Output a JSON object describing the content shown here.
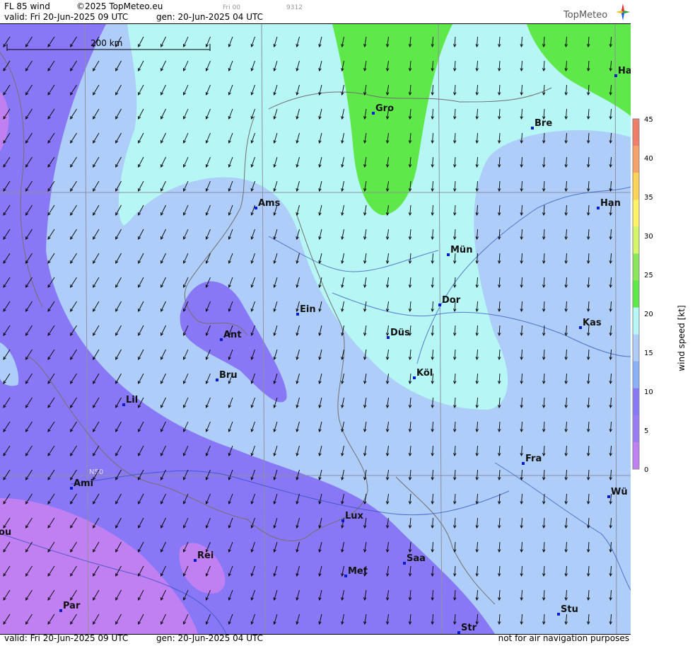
{
  "header": {
    "product": "FL 85 wind",
    "copyright": "©2025 TopMeteo.eu",
    "day_code": "Fri 00",
    "code": "9312",
    "valid": "valid:  Fri  20-Jun-2025  09 UTC",
    "gen": "gen: 20-Jun-2025 04 UTC",
    "logo": "TopMeteo"
  },
  "footer": {
    "valid": "valid:  Fri  20-Jun-2025  09 UTC",
    "gen": "gen: 20-Jun-2025 04 UTC",
    "disclaimer": "not for air navigation purposes"
  },
  "map": {
    "scale_label": "200 km",
    "grid_label": "N50",
    "cities": [
      {
        "name": "Gro"
      },
      {
        "name": "Bre"
      },
      {
        "name": "Ha"
      },
      {
        "name": "Ams"
      },
      {
        "name": "Han"
      },
      {
        "name": "Mün"
      },
      {
        "name": "Dor"
      },
      {
        "name": "Ein"
      },
      {
        "name": "Ant"
      },
      {
        "name": "Düs"
      },
      {
        "name": "Kas"
      },
      {
        "name": "Bru"
      },
      {
        "name": "Köl"
      },
      {
        "name": "Lil"
      },
      {
        "name": "Fra"
      },
      {
        "name": "Ami"
      },
      {
        "name": "Wü"
      },
      {
        "name": "Lux"
      },
      {
        "name": "Rei"
      },
      {
        "name": "Saa"
      },
      {
        "name": "Met"
      },
      {
        "name": "ou"
      },
      {
        "name": "Par"
      },
      {
        "name": "Stu"
      },
      {
        "name": "Str"
      }
    ]
  },
  "colorbar": {
    "title": "wind speed [kt]",
    "ticks": [
      "45",
      "40",
      "35",
      "30",
      "25",
      "20",
      "15",
      "10",
      "5",
      "0"
    ],
    "colors": [
      "#f07e68",
      "#f6a06a",
      "#ffd25a",
      "#fff36a",
      "#d5f56a",
      "#8ae85a",
      "#5ee84a",
      "#b6f6f4",
      "#aecdf8",
      "#8ab0f6",
      "#8878f6",
      "#9a7cf4",
      "#c080f2"
    ]
  }
}
